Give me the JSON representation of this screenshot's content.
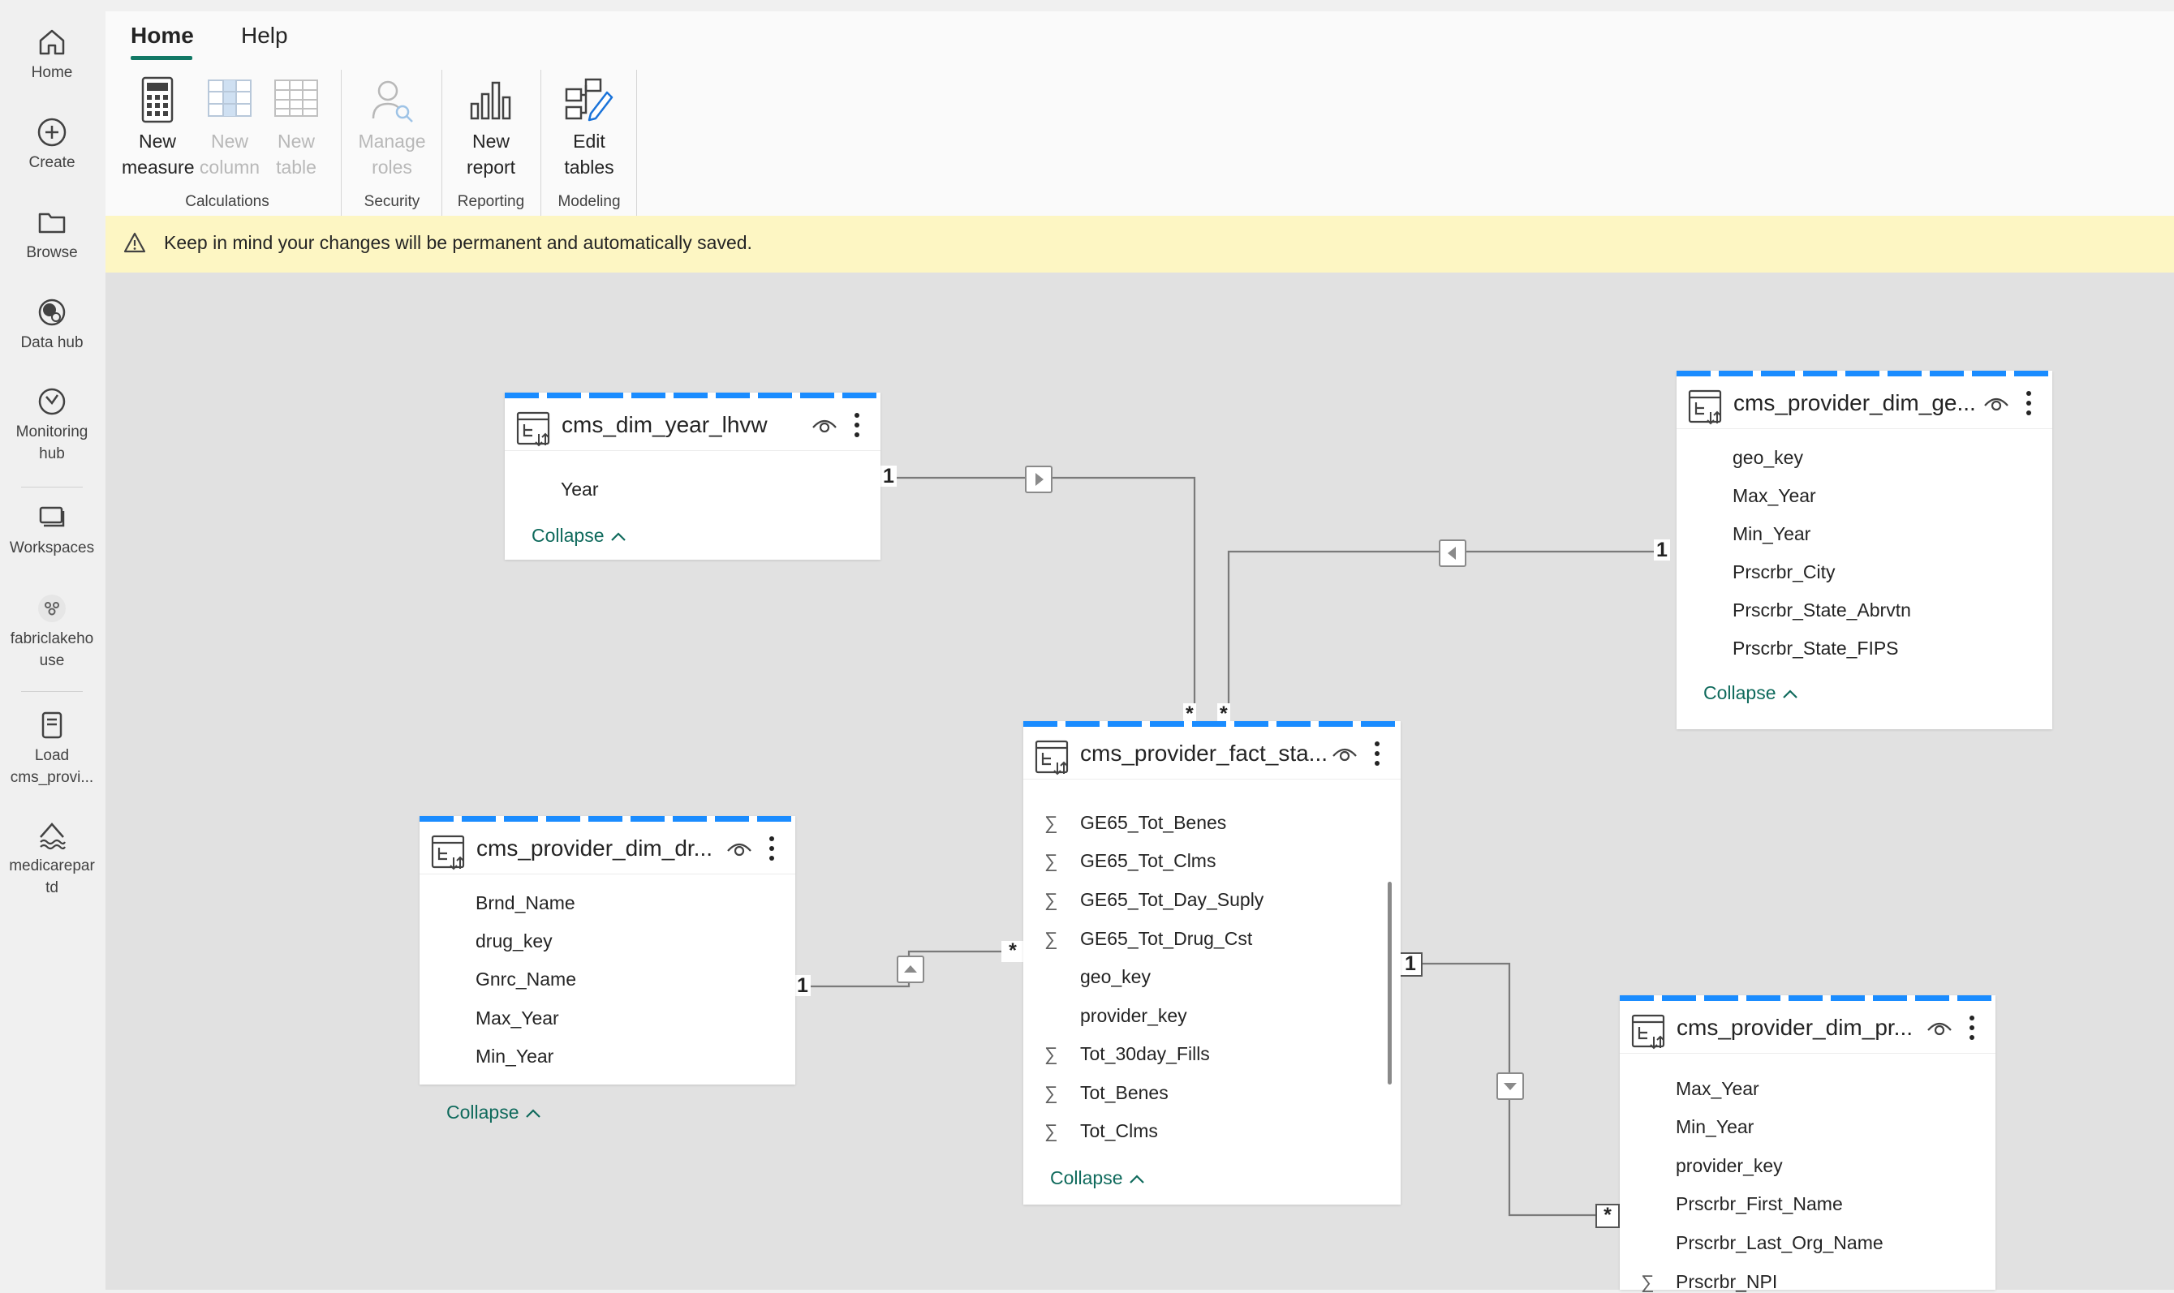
{
  "nav": {
    "home": "Home",
    "create": "Create",
    "browse": "Browse",
    "data_hub": "Data hub",
    "monitoring_line1": "Monitoring",
    "monitoring_line2": "hub",
    "workspaces": "Workspaces",
    "lakehouse_line1": "fabriclakeho",
    "lakehouse_line2": "use",
    "load_line1": "Load",
    "load_line2": "cms_provi...",
    "medicare_line1": "medicarepar",
    "medicare_line2": "td"
  },
  "ribbon": {
    "tabs": [
      "Home",
      "Help"
    ],
    "active_tab": "Home",
    "buttons": {
      "new_measure": [
        "New",
        "measure"
      ],
      "new_column": [
        "New",
        "column"
      ],
      "new_table": [
        "New",
        "table"
      ],
      "manage_roles": [
        "Manage",
        "roles"
      ],
      "new_report": [
        "New",
        "report"
      ],
      "edit_tables": [
        "Edit",
        "tables"
      ]
    },
    "groups": {
      "calculations": "Calculations",
      "security": "Security",
      "reporting": "Reporting",
      "modeling": "Modeling"
    }
  },
  "banner": {
    "text": "Keep in mind your changes will be permanent and automatically saved."
  },
  "tables": {
    "year": {
      "title": "cms_dim_year_lhvw",
      "fields": [
        "Year"
      ],
      "collapse": "Collapse"
    },
    "geo": {
      "title": "cms_provider_dim_ge...",
      "fields": [
        "geo_key",
        "Max_Year",
        "Min_Year",
        "Prscrbr_City",
        "Prscrbr_State_Abrvtn",
        "Prscrbr_State_FIPS"
      ],
      "collapse": "Collapse"
    },
    "drug": {
      "title": "cms_provider_dim_dr...",
      "fields": [
        "Brnd_Name",
        "drug_key",
        "Gnrc_Name",
        "Max_Year",
        "Min_Year"
      ],
      "collapse": "Collapse"
    },
    "fact": {
      "title": "cms_provider_fact_sta...",
      "fields": [
        {
          "name": "GE65_Tot_Benes",
          "sigma": "∑"
        },
        {
          "name": "GE65_Tot_Clms",
          "sigma": "∑"
        },
        {
          "name": "GE65_Tot_Day_Suply",
          "sigma": "∑"
        },
        {
          "name": "GE65_Tot_Drug_Cst",
          "sigma": "∑"
        },
        {
          "name": "geo_key",
          "sigma": ""
        },
        {
          "name": "provider_key",
          "sigma": ""
        },
        {
          "name": "Tot_30day_Fills",
          "sigma": "∑"
        },
        {
          "name": "Tot_Benes",
          "sigma": "∑"
        },
        {
          "name": "Tot_Clms",
          "sigma": "∑"
        }
      ],
      "collapse": "Collapse"
    },
    "provider": {
      "title": "cms_provider_dim_pr...",
      "fields": [
        {
          "name": "Max_Year",
          "sigma": ""
        },
        {
          "name": "Min_Year",
          "sigma": ""
        },
        {
          "name": "provider_key",
          "sigma": ""
        },
        {
          "name": "Prscrbr_First_Name",
          "sigma": ""
        },
        {
          "name": "Prscrbr_Last_Org_Name",
          "sigma": ""
        },
        {
          "name": "Prscrbr_NPI",
          "sigma": "∑"
        }
      ]
    }
  },
  "relationships": {
    "one": "1",
    "many": "*"
  },
  "colors": {
    "accent": "#117865",
    "stripe": "#1a8cff",
    "banner": "#fdf6c3",
    "canvas": "#e1e1e1"
  }
}
